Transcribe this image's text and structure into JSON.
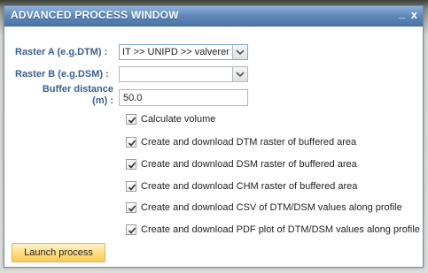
{
  "window": {
    "title": "ADVANCED PROCESS WINDOW",
    "minimize_label": "_",
    "close_label": "x"
  },
  "form": {
    "raster_a": {
      "label": "Raster A (e.g.DTM) :",
      "value": "IT >> UNIPD >> valveren"
    },
    "raster_b": {
      "label": "Raster B (e.g.DSM) :",
      "value": ""
    },
    "buffer": {
      "label_line1": "Buffer distance",
      "label_line2": "(m) :",
      "value": "50.0"
    },
    "options": [
      {
        "label": "Calculate volume",
        "checked": true
      },
      {
        "label": "Create and download DTM raster of buffered area",
        "checked": true
      },
      {
        "label": "Create and download DSM raster of buffered area",
        "checked": true
      },
      {
        "label": "Create and download CHM raster of buffered area",
        "checked": true
      },
      {
        "label": "Create and download CSV of DTM/DSM values along profile",
        "checked": true
      },
      {
        "label": "Create and download PDF plot of DTM/DSM values along profile",
        "checked": true
      }
    ]
  },
  "actions": {
    "launch_label": "Launch process"
  },
  "colors": {
    "title_bar": "#5f87b8",
    "label": "#3a5f8f",
    "launch_button": "#ffd978"
  }
}
